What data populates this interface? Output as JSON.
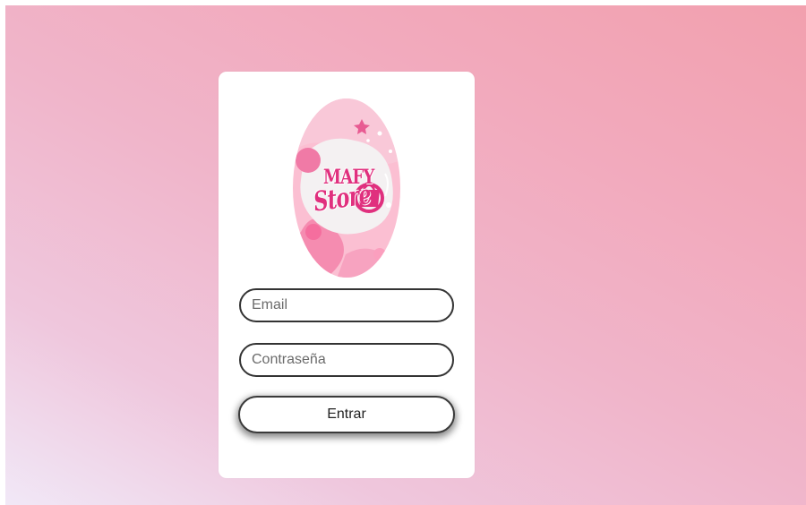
{
  "login": {
    "logo_icon": "mafy-store-logo",
    "logo_text_top": "MAFY",
    "logo_text_bottom": "Store",
    "email_placeholder": "Email",
    "email_value": "",
    "password_placeholder": "Contraseña",
    "password_value": "",
    "submit_label": "Entrar"
  },
  "colors": {
    "background_start": "#f1e8f7",
    "background_end": "#f2a0ae",
    "card": "#ffffff",
    "logo_pink": "#fbb4cb",
    "logo_accent": "#e0307e",
    "field_border": "#333333"
  }
}
